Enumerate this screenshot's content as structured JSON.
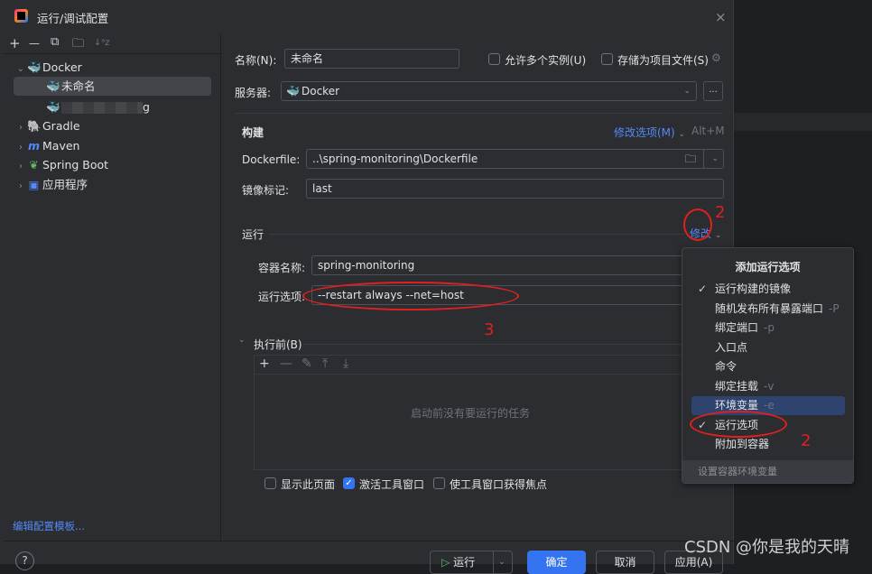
{
  "window": {
    "title": "运行/调试配置",
    "close": "×"
  },
  "left_toolbar": {
    "add": "+",
    "remove": "—",
    "copy": "⧉",
    "new_folder": "🗀",
    "sort": "↓ᵃz"
  },
  "tree": {
    "items": [
      {
        "label": "Docker",
        "icon": "docker-icon",
        "expanded": true
      },
      {
        "label": "未命名",
        "icon": "docker-icon",
        "selected": true
      },
      {
        "label": "g",
        "icon": "docker-icon",
        "redacted": true
      },
      {
        "label": "Gradle",
        "icon": "gradle-icon"
      },
      {
        "label": "Maven",
        "icon": "maven-icon"
      },
      {
        "label": "Spring Boot",
        "icon": "spring-boot-icon"
      },
      {
        "label": "应用程序",
        "icon": "application-icon"
      }
    ]
  },
  "edit_templates": "编辑配置模板...",
  "form": {
    "name_label": "名称(N):",
    "name_value": "未命名",
    "allow_multiple": "允许多个实例(U)",
    "store_as_file": "存储为项目文件(S)",
    "server_label": "服务器:",
    "server_value": "Docker",
    "more": "...",
    "build_section": "构建",
    "modify_options": "修改选项(M)",
    "modify_shortcut": "Alt+M",
    "dockerfile_label": "Dockerfile:",
    "dockerfile_value": "..\\spring-monitoring\\Dockerfile",
    "image_tag_label": "镜像标记:",
    "image_tag_value": "last",
    "run_section": "运行",
    "modify": "修改",
    "container_name_label": "容器名称:",
    "container_name_value": "spring-monitoring",
    "run_options_label": "运行选项:",
    "run_options_value": "--restart always --net=host",
    "before_launch": "执行前(B)",
    "no_tasks": "启动前没有要运行的任务",
    "show_page": "显示此页面",
    "activate_tool_window": "激活工具窗口",
    "focus_tool_window": "使工具窗口获得焦点"
  },
  "footer": {
    "help": "?",
    "run": "运行",
    "ok": "确定",
    "cancel": "取消",
    "apply": "应用(A)"
  },
  "popup": {
    "title": "添加运行选项",
    "items": [
      {
        "label": "运行构建的镜像",
        "checked": true,
        "shortcut": ""
      },
      {
        "label": "随机发布所有暴露端口",
        "checked": false,
        "shortcut": "-P"
      },
      {
        "label": "绑定端口",
        "checked": false,
        "shortcut": "-p"
      },
      {
        "label": "入口点",
        "checked": false,
        "shortcut": ""
      },
      {
        "label": "命令",
        "checked": false,
        "shortcut": ""
      },
      {
        "label": "绑定挂载",
        "checked": false,
        "shortcut": "-v"
      },
      {
        "label": "环境变量",
        "checked": false,
        "shortcut": "-e",
        "highlighted": true
      },
      {
        "label": "运行选项",
        "checked": true,
        "shortcut": ""
      },
      {
        "label": "附加到容器",
        "checked": false,
        "shortcut": ""
      }
    ],
    "footer": "设置容器环境变量"
  },
  "annotations": {
    "n2a": "2",
    "n2b": "2",
    "n3": "3"
  },
  "watermark": "CSDN @你是我的天晴"
}
